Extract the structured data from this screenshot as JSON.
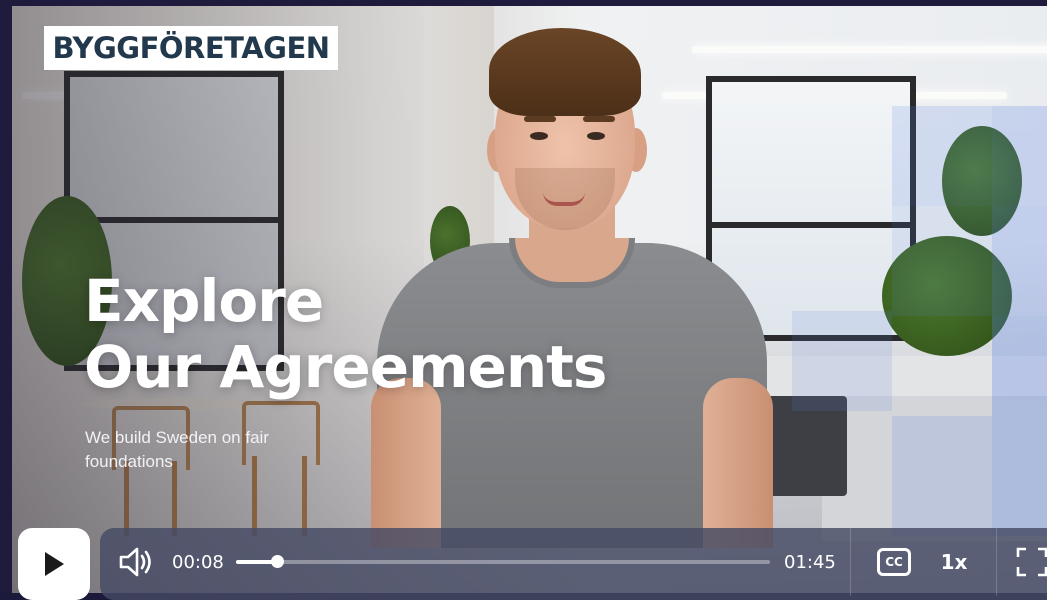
{
  "brand": {
    "logo_text": "BYGGFÖRETAGEN",
    "logo_color": "#22384c"
  },
  "hero": {
    "headline_line1": "Explore",
    "headline_line2": "Our Agreements",
    "subline": "We build Sweden on fair foundations"
  },
  "player": {
    "state": "paused",
    "current_time": "00:08",
    "duration": "01:45",
    "progress": 0.076,
    "speed_label": "1x",
    "captions_label": "CC",
    "icons": [
      "play-icon",
      "volume-icon",
      "captions-icon",
      "fullscreen-icon"
    ],
    "bar_color": "#464a64",
    "button_color": "#ffffff"
  }
}
